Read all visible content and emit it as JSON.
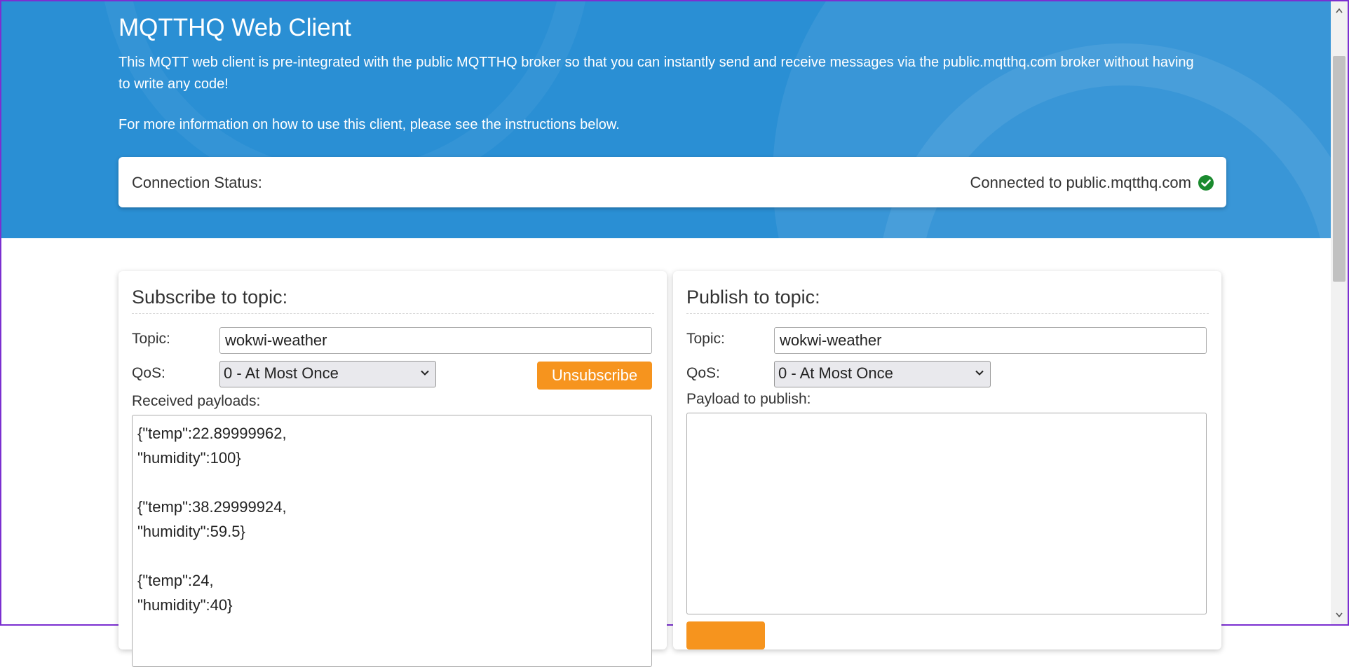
{
  "header": {
    "title": "MQTTHQ Web Client",
    "description": "This MQTT web client is pre-integrated with the public MQTTHQ broker so that you can instantly send and receive messages via the public.mqtthq.com broker without having to write any code!",
    "more_info": "For more information on how to use this client, please see the instructions below."
  },
  "status": {
    "label": "Connection Status:",
    "value": "Connected to public.mqtthq.com",
    "icon": "check-circle-icon",
    "icon_color": "#1a8a2e"
  },
  "subscribe": {
    "title": "Subscribe to topic:",
    "topic_label": "Topic:",
    "topic_value": "wokwi-weather",
    "qos_label": "QoS:",
    "qos_selected": "0 - At Most Once",
    "unsubscribe_label": "Unsubscribe",
    "received_label": "Received payloads:",
    "received_text": "{\"temp\":22.89999962,\n\"humidity\":100}\n\n{\"temp\":38.29999924,\n\"humidity\":59.5}\n\n{\"temp\":24,\n\"humidity\":40}"
  },
  "publish": {
    "title": "Publish to topic:",
    "topic_label": "Topic:",
    "topic_value": "wokwi-weather",
    "qos_label": "QoS:",
    "qos_selected": "0 - At Most Once",
    "payload_label": "Payload to publish:",
    "payload_value": ""
  },
  "colors": {
    "header_bg": "#2a8fd4",
    "accent_button": "#f6941e"
  }
}
